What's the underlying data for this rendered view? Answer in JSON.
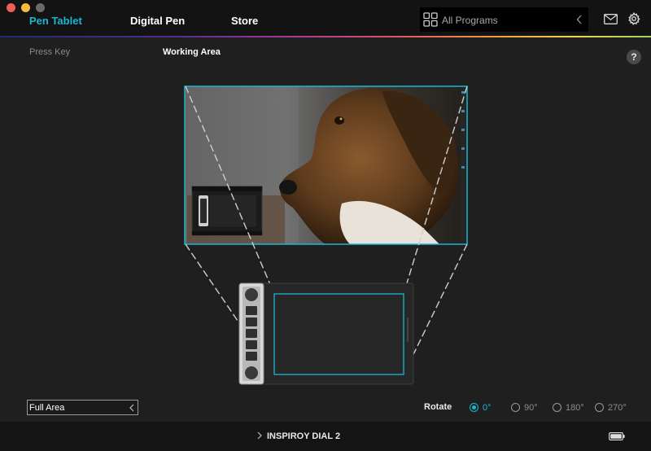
{
  "window": {
    "traffic_lights": [
      "close",
      "minimize",
      "zoom"
    ]
  },
  "tabs": [
    {
      "label": "Pen Tablet",
      "active": true
    },
    {
      "label": "Digital Pen",
      "active": false
    },
    {
      "label": "Store",
      "active": false
    }
  ],
  "programs": {
    "label": "All Programs",
    "icon": "grid-icon"
  },
  "header_icons": {
    "mail": "mail-icon",
    "settings": "gear-icon"
  },
  "subnav": {
    "press_key": "Press Key",
    "working_area": "Working Area"
  },
  "help": {
    "label": "?"
  },
  "area": {
    "selected": "Full Area"
  },
  "rotate": {
    "label": "Rotate",
    "options": [
      "0°",
      "90°",
      "180°",
      "270°"
    ],
    "selected": "0°"
  },
  "footer": {
    "device_name": "INSPIROY DIAL 2",
    "battery_icon": "battery-icon"
  },
  "colors": {
    "accent": "#19b7d2",
    "background": "#1f1f1f",
    "header": "#131313"
  }
}
